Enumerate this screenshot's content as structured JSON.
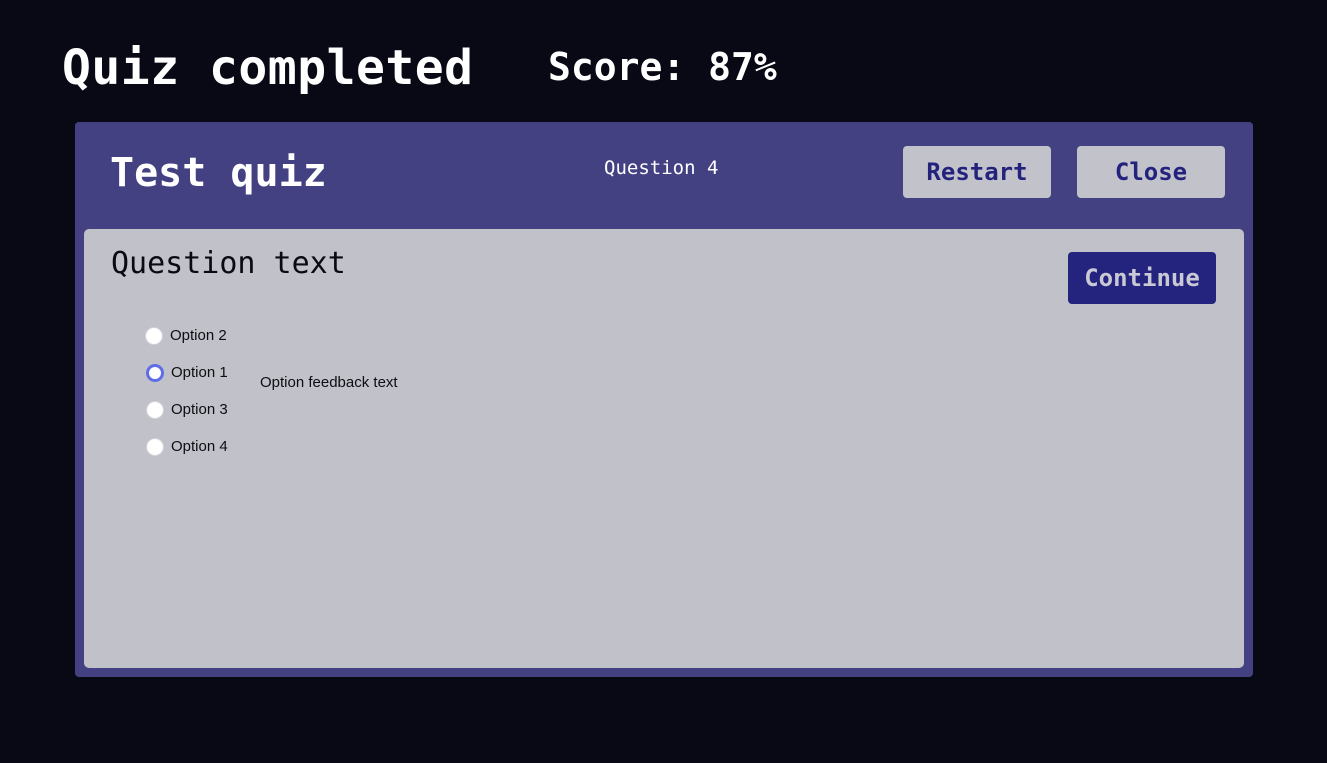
{
  "page": {
    "heading": "Quiz completed",
    "score": "Score: 87%"
  },
  "quiz": {
    "title": "Test quiz",
    "question_counter": "Question 4",
    "restart_label": "Restart",
    "close_label": "Close",
    "question_text": "Question text",
    "continue_label": "Continue",
    "options": [
      {
        "label": "Option 2",
        "selected": false
      },
      {
        "label": "Option 1",
        "selected": true
      },
      {
        "label": "Option 3",
        "selected": false
      },
      {
        "label": "Option 4",
        "selected": false
      }
    ],
    "feedback": "Option feedback text"
  },
  "colors": {
    "background": "#080914",
    "panel": "#444183",
    "card": "#c1c1c9",
    "button_light": "#c2c2cb",
    "button_dark": "#24247f",
    "button_text_dark": "#23237e",
    "radio_selected": "#5f6ee8"
  }
}
